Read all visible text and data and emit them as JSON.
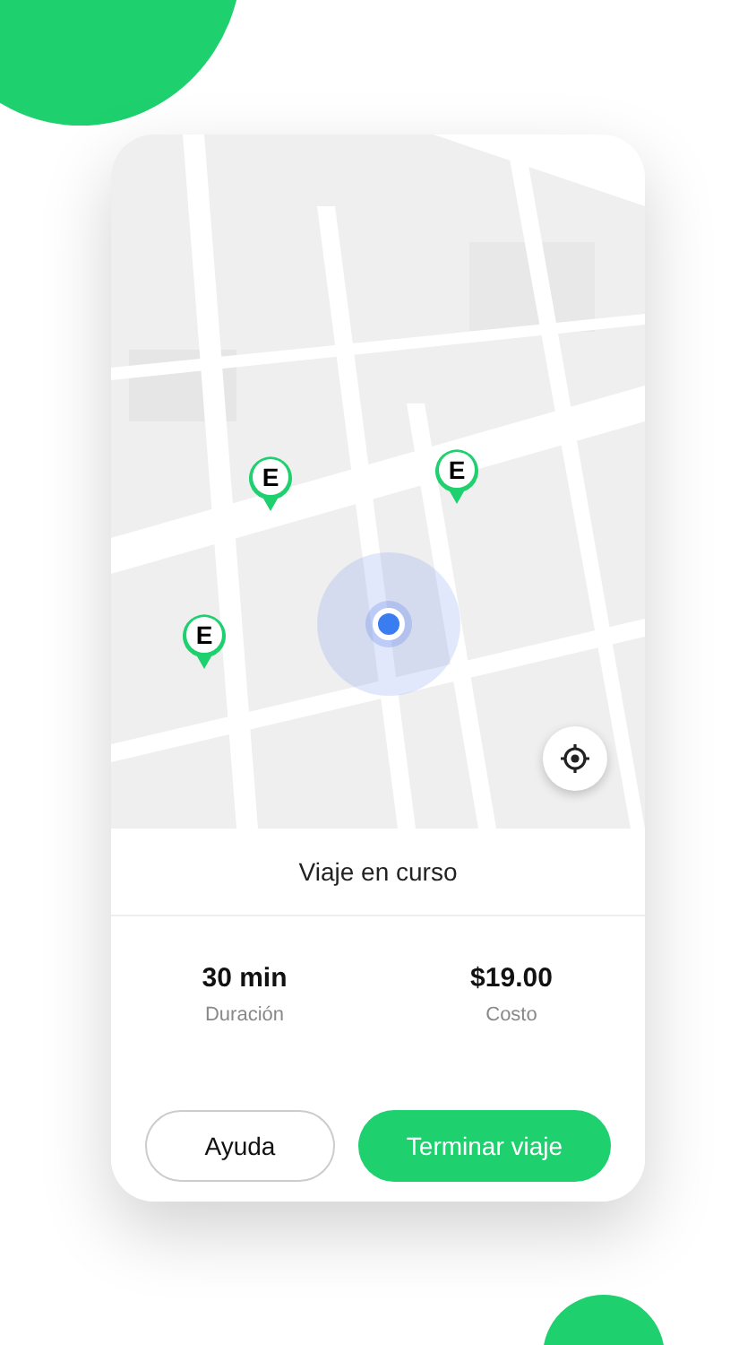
{
  "map": {
    "kind": "picture",
    "pins": [
      {
        "label": "E"
      },
      {
        "label": "E"
      },
      {
        "label": "E"
      }
    ]
  },
  "trip": {
    "title": "Viaje en curso",
    "stats": [
      {
        "value": "30 min",
        "label": "Duración"
      },
      {
        "value": "$19.00",
        "label": "Costo"
      }
    ],
    "buttons": [
      {
        "label": "Ayuda",
        "kind": "outline"
      },
      {
        "label": "Terminar viaje",
        "kind": "primary"
      }
    ]
  }
}
